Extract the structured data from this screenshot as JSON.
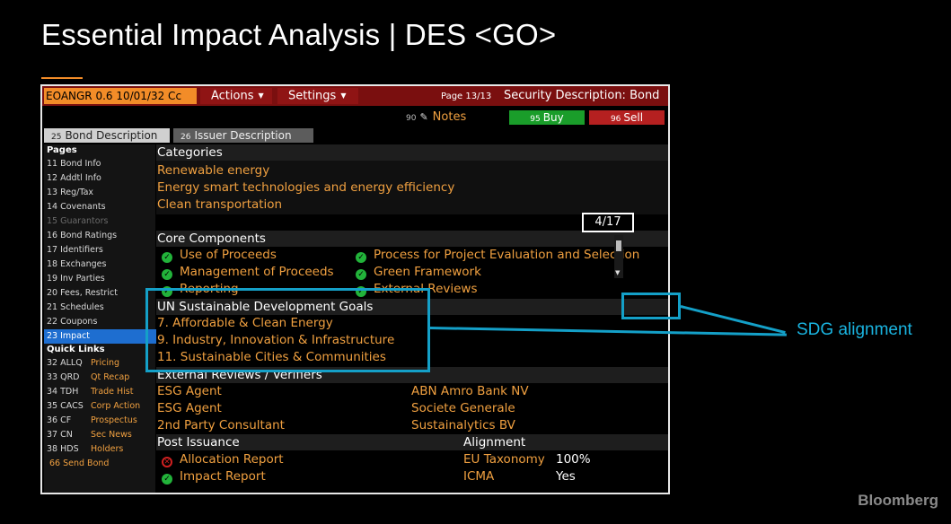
{
  "slide": {
    "title": "Essential Impact Analysis | DES <GO>",
    "brand": "Bloomberg",
    "callout": "SDG alignment"
  },
  "toolbar": {
    "ticker": "EOANGR 0.6 10/01/32 Cc",
    "actions": "Actions",
    "settings": "Settings",
    "page": "Page 13/13",
    "security_desc": "Security Description: Bond",
    "notes_key": "90",
    "notes": "Notes",
    "buy_key": "95",
    "buy": "Buy",
    "sell_key": "96",
    "sell": "Sell"
  },
  "tabs": [
    {
      "key": "25",
      "label": "Bond Description"
    },
    {
      "key": "26",
      "label": "Issuer Description"
    }
  ],
  "sidebar": {
    "pages_header": "Pages",
    "pages": [
      "11 Bond Info",
      "12 Addtl Info",
      "13 Reg/Tax",
      "14 Covenants",
      "15 Guarantors",
      "16 Bond Ratings",
      "17 Identifiers",
      "18 Exchanges",
      "19 Inv Parties",
      "20 Fees, Restrict",
      "21 Schedules",
      "22 Coupons",
      "23 Impact"
    ],
    "quick_header": "Quick Links",
    "quick": [
      {
        "code": "32 ALLQ",
        "label": "Pricing"
      },
      {
        "code": "33 QRD",
        "label": "Qt Recap"
      },
      {
        "code": "34 TDH",
        "label": "Trade Hist"
      },
      {
        "code": "35 CACS",
        "label": "Corp Action"
      },
      {
        "code": "36 CF",
        "label": "Prospectus"
      },
      {
        "code": "37 CN",
        "label": "Sec News"
      },
      {
        "code": "38 HDS",
        "label": "Holders"
      }
    ],
    "send_bond": "66 Send Bond"
  },
  "categories": {
    "header": "Categories",
    "items": [
      "Renewable energy",
      "Energy smart technologies and energy efficiency",
      "Clean transportation"
    ]
  },
  "core": {
    "header": "Core Components",
    "left": [
      "Use of Proceeds",
      "Management of Proceeds",
      "Reporting"
    ],
    "right": [
      "Process for Project Evaluation and Selection",
      "Green Framework",
      "External Reviews"
    ]
  },
  "sdg": {
    "header": "UN Sustainable Development Goals",
    "counter": "4/17",
    "items": [
      "7. Affordable & Clean Energy",
      "9. Industry, Innovation & Infrastructure",
      "11. Sustainable Cities & Communities"
    ]
  },
  "reviews": {
    "header": "External Reviews / Verifiers",
    "rows": [
      {
        "role": "ESG Agent",
        "name": "ABN Amro Bank NV"
      },
      {
        "role": "ESG Agent",
        "name": "Societe Generale"
      },
      {
        "role": "2nd Party Consultant",
        "name": "Sustainalytics BV"
      }
    ]
  },
  "post": {
    "header": "Post Issuance",
    "alloc": "Allocation Report",
    "impact": "Impact Report",
    "align_header": "Alignment",
    "align": [
      {
        "label": "EU Taxonomy",
        "value": "100%"
      },
      {
        "label": "ICMA",
        "value": "Yes"
      }
    ]
  }
}
